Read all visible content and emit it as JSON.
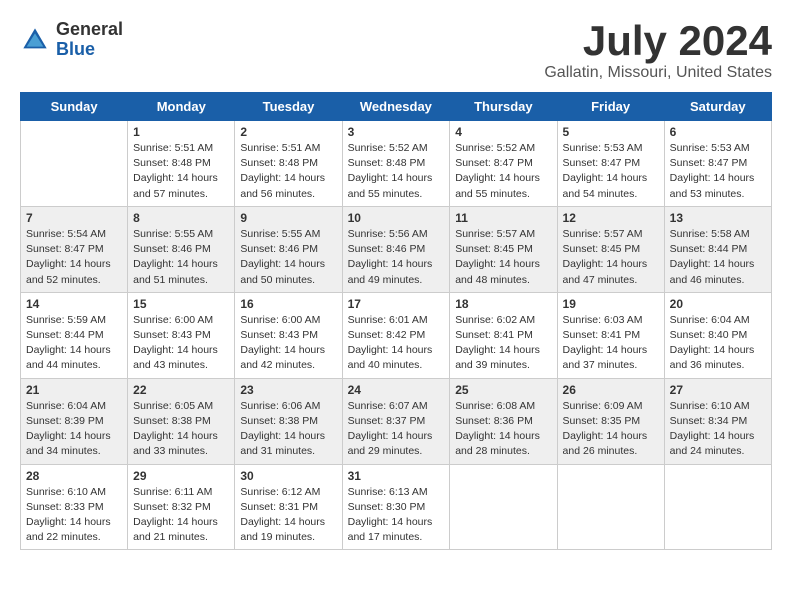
{
  "header": {
    "logo_general": "General",
    "logo_blue": "Blue",
    "month_title": "July 2024",
    "location": "Gallatin, Missouri, United States"
  },
  "weekdays": [
    "Sunday",
    "Monday",
    "Tuesday",
    "Wednesday",
    "Thursday",
    "Friday",
    "Saturday"
  ],
  "weeks": [
    [
      {
        "day": "",
        "info": ""
      },
      {
        "day": "1",
        "info": "Sunrise: 5:51 AM\nSunset: 8:48 PM\nDaylight: 14 hours\nand 57 minutes."
      },
      {
        "day": "2",
        "info": "Sunrise: 5:51 AM\nSunset: 8:48 PM\nDaylight: 14 hours\nand 56 minutes."
      },
      {
        "day": "3",
        "info": "Sunrise: 5:52 AM\nSunset: 8:48 PM\nDaylight: 14 hours\nand 55 minutes."
      },
      {
        "day": "4",
        "info": "Sunrise: 5:52 AM\nSunset: 8:47 PM\nDaylight: 14 hours\nand 55 minutes."
      },
      {
        "day": "5",
        "info": "Sunrise: 5:53 AM\nSunset: 8:47 PM\nDaylight: 14 hours\nand 54 minutes."
      },
      {
        "day": "6",
        "info": "Sunrise: 5:53 AM\nSunset: 8:47 PM\nDaylight: 14 hours\nand 53 minutes."
      }
    ],
    [
      {
        "day": "7",
        "info": "Sunrise: 5:54 AM\nSunset: 8:47 PM\nDaylight: 14 hours\nand 52 minutes."
      },
      {
        "day": "8",
        "info": "Sunrise: 5:55 AM\nSunset: 8:46 PM\nDaylight: 14 hours\nand 51 minutes."
      },
      {
        "day": "9",
        "info": "Sunrise: 5:55 AM\nSunset: 8:46 PM\nDaylight: 14 hours\nand 50 minutes."
      },
      {
        "day": "10",
        "info": "Sunrise: 5:56 AM\nSunset: 8:46 PM\nDaylight: 14 hours\nand 49 minutes."
      },
      {
        "day": "11",
        "info": "Sunrise: 5:57 AM\nSunset: 8:45 PM\nDaylight: 14 hours\nand 48 minutes."
      },
      {
        "day": "12",
        "info": "Sunrise: 5:57 AM\nSunset: 8:45 PM\nDaylight: 14 hours\nand 47 minutes."
      },
      {
        "day": "13",
        "info": "Sunrise: 5:58 AM\nSunset: 8:44 PM\nDaylight: 14 hours\nand 46 minutes."
      }
    ],
    [
      {
        "day": "14",
        "info": "Sunrise: 5:59 AM\nSunset: 8:44 PM\nDaylight: 14 hours\nand 44 minutes."
      },
      {
        "day": "15",
        "info": "Sunrise: 6:00 AM\nSunset: 8:43 PM\nDaylight: 14 hours\nand 43 minutes."
      },
      {
        "day": "16",
        "info": "Sunrise: 6:00 AM\nSunset: 8:43 PM\nDaylight: 14 hours\nand 42 minutes."
      },
      {
        "day": "17",
        "info": "Sunrise: 6:01 AM\nSunset: 8:42 PM\nDaylight: 14 hours\nand 40 minutes."
      },
      {
        "day": "18",
        "info": "Sunrise: 6:02 AM\nSunset: 8:41 PM\nDaylight: 14 hours\nand 39 minutes."
      },
      {
        "day": "19",
        "info": "Sunrise: 6:03 AM\nSunset: 8:41 PM\nDaylight: 14 hours\nand 37 minutes."
      },
      {
        "day": "20",
        "info": "Sunrise: 6:04 AM\nSunset: 8:40 PM\nDaylight: 14 hours\nand 36 minutes."
      }
    ],
    [
      {
        "day": "21",
        "info": "Sunrise: 6:04 AM\nSunset: 8:39 PM\nDaylight: 14 hours\nand 34 minutes."
      },
      {
        "day": "22",
        "info": "Sunrise: 6:05 AM\nSunset: 8:38 PM\nDaylight: 14 hours\nand 33 minutes."
      },
      {
        "day": "23",
        "info": "Sunrise: 6:06 AM\nSunset: 8:38 PM\nDaylight: 14 hours\nand 31 minutes."
      },
      {
        "day": "24",
        "info": "Sunrise: 6:07 AM\nSunset: 8:37 PM\nDaylight: 14 hours\nand 29 minutes."
      },
      {
        "day": "25",
        "info": "Sunrise: 6:08 AM\nSunset: 8:36 PM\nDaylight: 14 hours\nand 28 minutes."
      },
      {
        "day": "26",
        "info": "Sunrise: 6:09 AM\nSunset: 8:35 PM\nDaylight: 14 hours\nand 26 minutes."
      },
      {
        "day": "27",
        "info": "Sunrise: 6:10 AM\nSunset: 8:34 PM\nDaylight: 14 hours\nand 24 minutes."
      }
    ],
    [
      {
        "day": "28",
        "info": "Sunrise: 6:10 AM\nSunset: 8:33 PM\nDaylight: 14 hours\nand 22 minutes."
      },
      {
        "day": "29",
        "info": "Sunrise: 6:11 AM\nSunset: 8:32 PM\nDaylight: 14 hours\nand 21 minutes."
      },
      {
        "day": "30",
        "info": "Sunrise: 6:12 AM\nSunset: 8:31 PM\nDaylight: 14 hours\nand 19 minutes."
      },
      {
        "day": "31",
        "info": "Sunrise: 6:13 AM\nSunset: 8:30 PM\nDaylight: 14 hours\nand 17 minutes."
      },
      {
        "day": "",
        "info": ""
      },
      {
        "day": "",
        "info": ""
      },
      {
        "day": "",
        "info": ""
      }
    ]
  ]
}
